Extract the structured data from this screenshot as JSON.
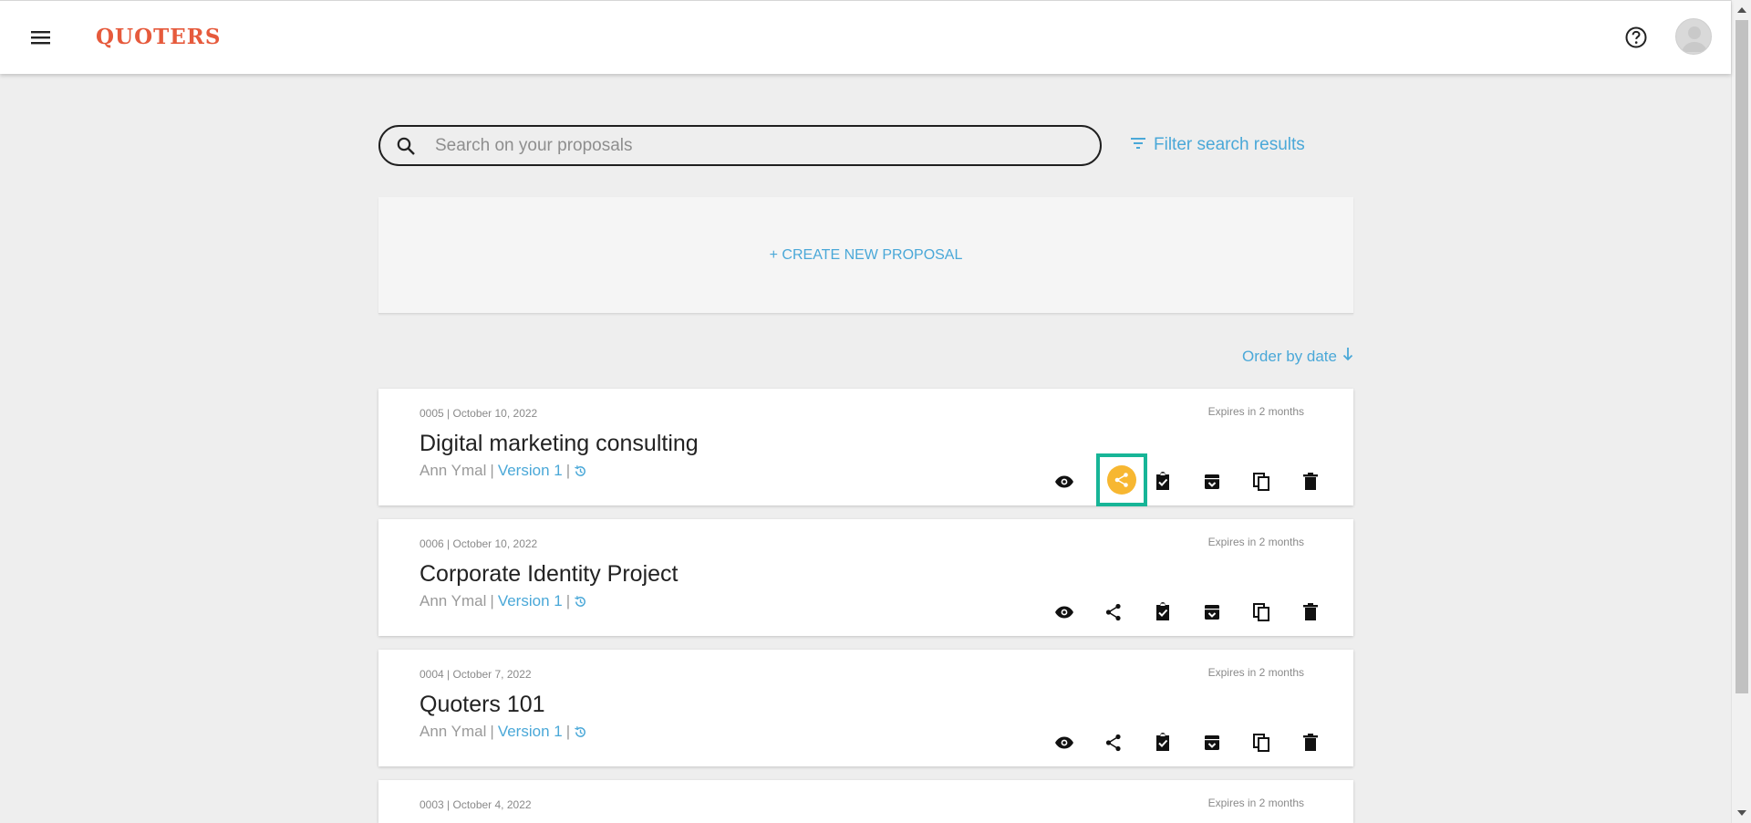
{
  "header": {
    "logo": "QUOTERS",
    "icons": {
      "menu": "hamburger-menu-icon",
      "help": "help-circle-icon",
      "avatar": "user-avatar"
    }
  },
  "search": {
    "placeholder": "Search on your proposals",
    "value": "",
    "filter_label": "Filter search results"
  },
  "create": {
    "label": "+ CREATE NEW PROPOSAL"
  },
  "order": {
    "label": "Order by date"
  },
  "colors": {
    "accent": "#4aa8d8",
    "brand": "#e65a3c",
    "share_active": "#f7b731",
    "highlight": "#17b597"
  },
  "proposals": [
    {
      "meta": "0005 | October 10, 2022",
      "expiry": "Expires in 2 months",
      "title": "Digital marketing consulting",
      "author": "Ann Ymal",
      "version": "Version 1"
    },
    {
      "meta": "0006 | October 10, 2022",
      "expiry": "Expires in 2 months",
      "title": "Corporate Identity Project",
      "author": "Ann Ymal",
      "version": "Version 1"
    },
    {
      "meta": "0004 | October 7, 2022",
      "expiry": "Expires in 2 months",
      "title": "Quoters 101",
      "author": "Ann Ymal",
      "version": "Version 1"
    },
    {
      "meta": "0003 | October 4, 2022",
      "expiry": "Expires in 2 months",
      "title": "",
      "author": "",
      "version": ""
    }
  ],
  "separator": "|"
}
